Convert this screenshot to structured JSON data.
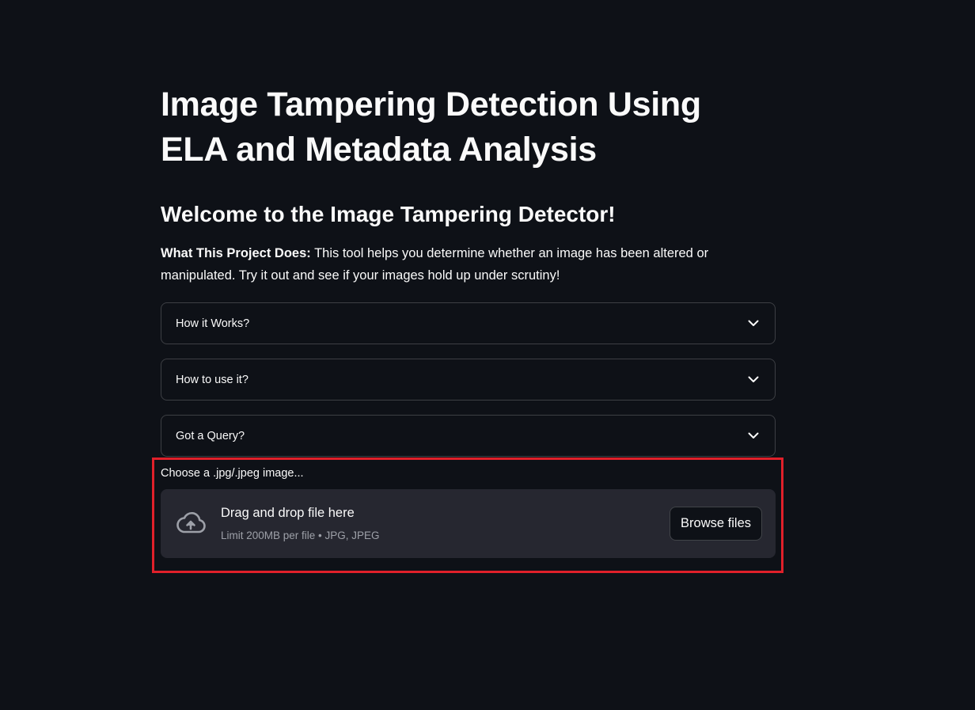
{
  "page": {
    "title": "Image Tampering Detection Using ELA and Metadata Analysis",
    "welcome": "Welcome to the Image Tampering Detector!",
    "description_bold": "What This Project Does:",
    "description_text": " This tool helps you determine whether an image has been altered or manipulated. Try it out and see if your images hold up under scrutiny!"
  },
  "expanders": [
    {
      "label": "How it Works?"
    },
    {
      "label": "How to use it?"
    },
    {
      "label": "Got a Query?"
    }
  ],
  "uploader": {
    "label": "Choose a .jpg/.jpeg image...",
    "drop_text": "Drag and drop file here",
    "limit_text": "Limit 200MB per file • JPG, JPEG",
    "button_label": "Browse files",
    "icon": "cloud-upload-icon"
  },
  "colors": {
    "background": "#0e1117",
    "dropzone": "#262730",
    "highlight_border": "#e0202a",
    "text": "#fafafa",
    "muted_text": "#9da0a8"
  }
}
